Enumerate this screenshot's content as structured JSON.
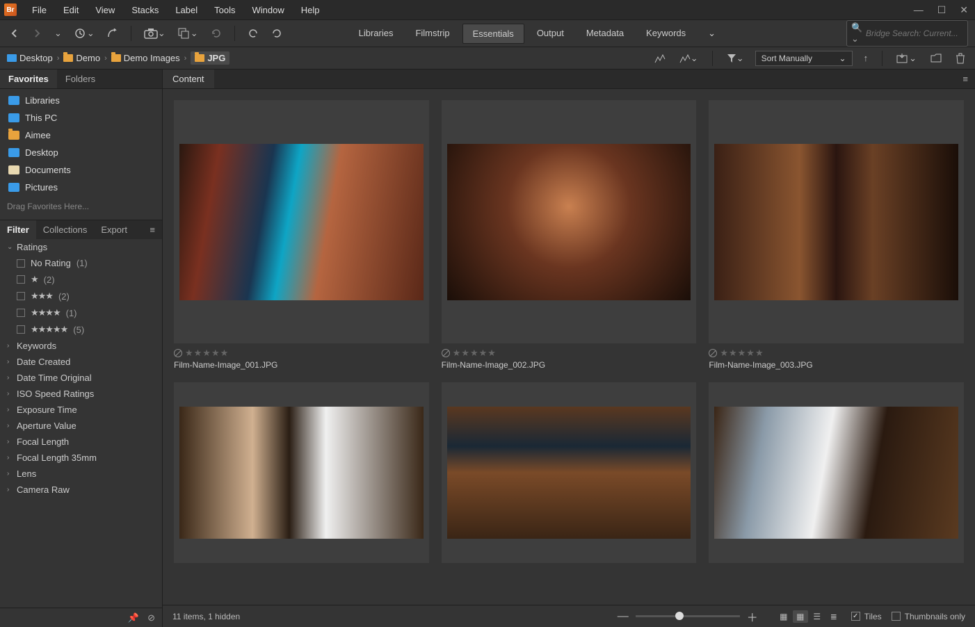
{
  "app": {
    "short": "Br"
  },
  "menubar": [
    "File",
    "Edit",
    "View",
    "Stacks",
    "Label",
    "Tools",
    "Window",
    "Help"
  ],
  "workspaces": [
    "Libraries",
    "Filmstrip",
    "Essentials",
    "Output",
    "Metadata",
    "Keywords"
  ],
  "active_workspace": "Essentials",
  "search_placeholder": "Bridge Search: Current...",
  "breadcrumbs": [
    {
      "label": "Desktop",
      "icon": "desktop"
    },
    {
      "label": "Demo",
      "icon": "folder"
    },
    {
      "label": "Demo Images",
      "icon": "folder"
    },
    {
      "label": "JPG",
      "icon": "folder",
      "active": true
    }
  ],
  "sort_label": "Sort Manually",
  "left_tabs": {
    "favorites": "Favorites",
    "folders": "Folders"
  },
  "favorites": [
    {
      "label": "Libraries",
      "color": "#3a9be8"
    },
    {
      "label": "This PC",
      "color": "#3a9be8"
    },
    {
      "label": "Aimee",
      "color": "#e8a33d"
    },
    {
      "label": "Desktop",
      "color": "#3a9be8"
    },
    {
      "label": "Documents",
      "color": "#e8a33d"
    },
    {
      "label": "Pictures",
      "color": "#3a9be8"
    }
  ],
  "drag_hint": "Drag Favorites Here...",
  "filter_tabs": {
    "filter": "Filter",
    "collections": "Collections",
    "export": "Export"
  },
  "filter_groups": {
    "ratings": {
      "label": "Ratings",
      "expanded": true,
      "items": [
        {
          "label": "No Rating",
          "count": "(1)",
          "stars": 0
        },
        {
          "label": "★",
          "count": "(2)",
          "stars": 1
        },
        {
          "label": "★★★",
          "count": "(2)",
          "stars": 3
        },
        {
          "label": "★★★★",
          "count": "(1)",
          "stars": 4
        },
        {
          "label": "★★★★★",
          "count": "(5)",
          "stars": 5
        }
      ]
    },
    "others": [
      "Keywords",
      "Date Created",
      "Date Time Original",
      "ISO Speed Ratings",
      "Exposure Time",
      "Aperture Value",
      "Focal Length",
      "Focal Length 35mm",
      "Lens",
      "Camera Raw"
    ]
  },
  "content_tab": "Content",
  "thumbnails": [
    {
      "name": "Film-Name-Image_001.JPG",
      "ph": "ph1"
    },
    {
      "name": "Film-Name-Image_002.JPG",
      "ph": "ph2"
    },
    {
      "name": "Film-Name-Image_003.JPG",
      "ph": "ph3"
    },
    {
      "name": "",
      "ph": "ph4"
    },
    {
      "name": "",
      "ph": "ph5"
    },
    {
      "name": "",
      "ph": "ph6"
    }
  ],
  "status": {
    "summary": "11 items,  1 hidden",
    "tiles": "Tiles",
    "thumbs_only": "Thumbnails only"
  }
}
